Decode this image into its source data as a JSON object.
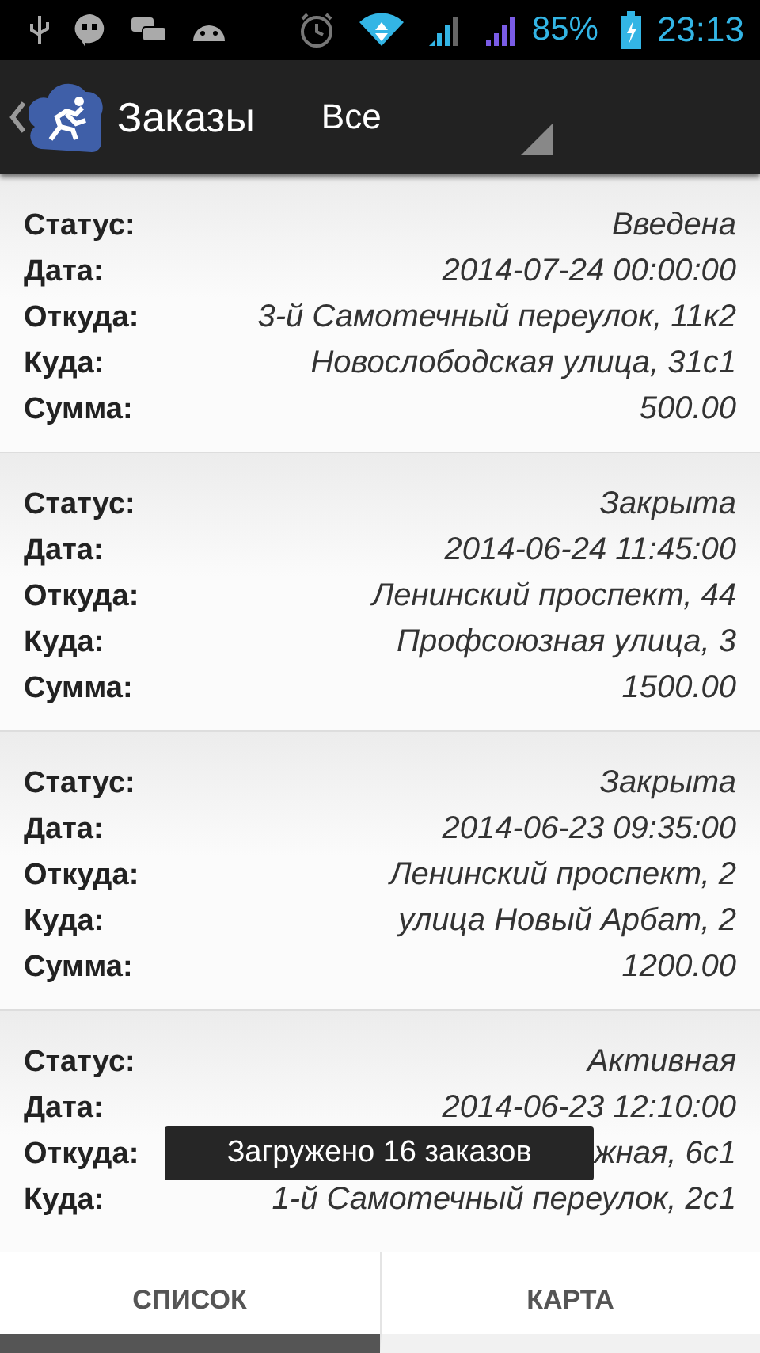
{
  "status_bar": {
    "battery": "85%",
    "time": "23:13"
  },
  "action_bar": {
    "title": "Заказы",
    "filter": "Все"
  },
  "orders": [
    {
      "fields": [
        {
          "label": "Статус:",
          "value": "Введена"
        },
        {
          "label": "Дата:",
          "value": "2014-07-24 00:00:00"
        },
        {
          "label": "Откуда:",
          "value": "3-й Самотечный переулок, 11к2"
        },
        {
          "label": "Куда:",
          "value": "Новослободская улица, 31с1"
        },
        {
          "label": "Сумма:",
          "value": "500.00"
        }
      ]
    },
    {
      "fields": [
        {
          "label": "Статус:",
          "value": "Закрыта"
        },
        {
          "label": "Дата:",
          "value": "2014-06-24 11:45:00"
        },
        {
          "label": "Откуда:",
          "value": "Ленинский проспект, 44"
        },
        {
          "label": "Куда:",
          "value": "Профсоюзная улица, 3"
        },
        {
          "label": "Сумма:",
          "value": "1500.00"
        }
      ]
    },
    {
      "fields": [
        {
          "label": "Статус:",
          "value": "Закрыта"
        },
        {
          "label": "Дата:",
          "value": "2014-06-23 09:35:00"
        },
        {
          "label": "Откуда:",
          "value": "Ленинский проспект, 2"
        },
        {
          "label": "Куда:",
          "value": "улица Новый Арбат, 2"
        },
        {
          "label": "Сумма:",
          "value": "1200.00"
        }
      ]
    },
    {
      "fields": [
        {
          "label": "Статус:",
          "value": "Активная"
        },
        {
          "label": "Дата:",
          "value": "2014-06-23 12:10:00"
        },
        {
          "label": "Откуда:",
          "value": "жная, 6с1"
        },
        {
          "label": "Куда:",
          "value": "1-й Самотечный переулок, 2с1"
        }
      ]
    }
  ],
  "toast": "Загружено 16 заказов",
  "tabs": [
    {
      "label": "СПИСОК",
      "selected": true
    },
    {
      "label": "КАРТА",
      "selected": false
    }
  ]
}
